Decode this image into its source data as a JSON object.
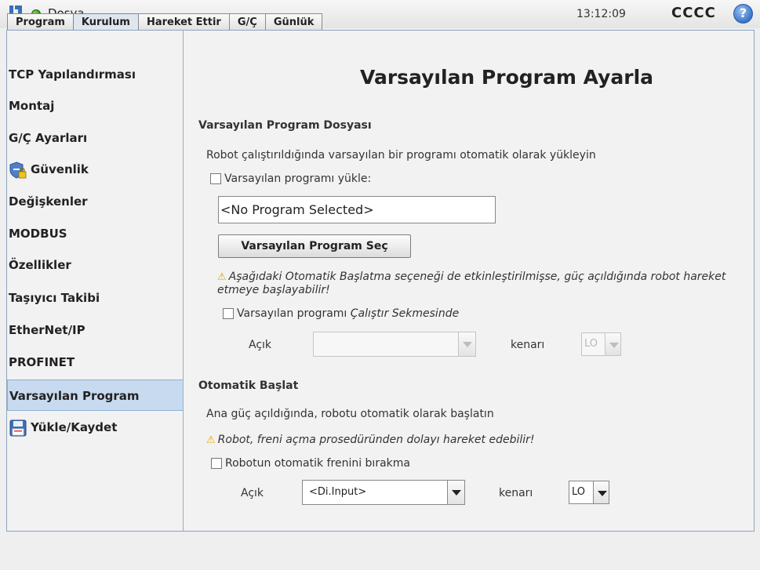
{
  "topbar": {
    "app_name": "Dosya",
    "clock": "13:12:09",
    "robot_name": "CCCC",
    "help_label": "?"
  },
  "tabs": [
    {
      "label": "Program"
    },
    {
      "label": "Kurulum"
    },
    {
      "label": "Hareket Ettir"
    },
    {
      "label": "G/Ç"
    },
    {
      "label": "Günlük"
    }
  ],
  "sidebar": {
    "items": [
      {
        "label": "TCP Yapılandırması"
      },
      {
        "label": "Montaj"
      },
      {
        "label": "G/Ç Ayarları"
      },
      {
        "label": "Güvenlik"
      },
      {
        "label": "Değişkenler"
      },
      {
        "label": "MODBUS"
      },
      {
        "label": "Özellikler"
      },
      {
        "label": "Taşıyıcı Takibi"
      },
      {
        "label": "EtherNet/IP"
      },
      {
        "label": "PROFINET"
      },
      {
        "label": "Varsayılan Program"
      },
      {
        "label": "Yükle/Kaydet"
      }
    ],
    "selected": "Varsayılan Program"
  },
  "main": {
    "title": "Varsayılan Program Ayarla",
    "default_file": {
      "section_title": "Varsayılan Program Dosyası",
      "description": "Robot çalıştırıldığında varsayılan bir programı otomatik olarak yükleyin",
      "load_checkbox_label": "Varsayılan programı yükle:",
      "load_checked": false,
      "program_field_value": "<No Program Selected>",
      "select_button_label": "Varsayılan Program Seç",
      "warning": "Aşağıdaki Otomatik Başlatma seçeneği de etkinleştirilmişse, güç açıldığında robot hareket etmeye başlayabilir!",
      "run_checkbox_label_prefix": "Varsayılan programı ",
      "run_checkbox_label_italic": "Çalıştır Sekmesinde",
      "run_checked": false,
      "input_label": "Açık",
      "input_value": "",
      "edge_label": "kenarı",
      "edge_value": "LO",
      "controls_enabled": false
    },
    "autostart": {
      "section_title": "Otomatik Başlat",
      "description": "Ana güç açıldığında, robotu otomatik olarak başlatın",
      "warning": "Robot, freni açma prosedüründen dolayı hareket edebilir!",
      "checkbox_label": "Robotun otomatik frenini bırakma",
      "checked": false,
      "input_label": "Açık",
      "input_value": "<Di.Input>",
      "edge_label": "kenarı",
      "edge_value": "LO"
    }
  },
  "colors": {
    "selected_nav": "#c8daef",
    "warning": "#e0a800",
    "status_ok": "#2f8a1a",
    "help": "#3a74c9"
  },
  "icons": {
    "logo": "ur-logo",
    "status": "status-dot-icon",
    "help": "help-icon",
    "safety": "shield-lock-icon",
    "save": "floppy-disk-icon",
    "warning": "warning-triangle-icon"
  }
}
